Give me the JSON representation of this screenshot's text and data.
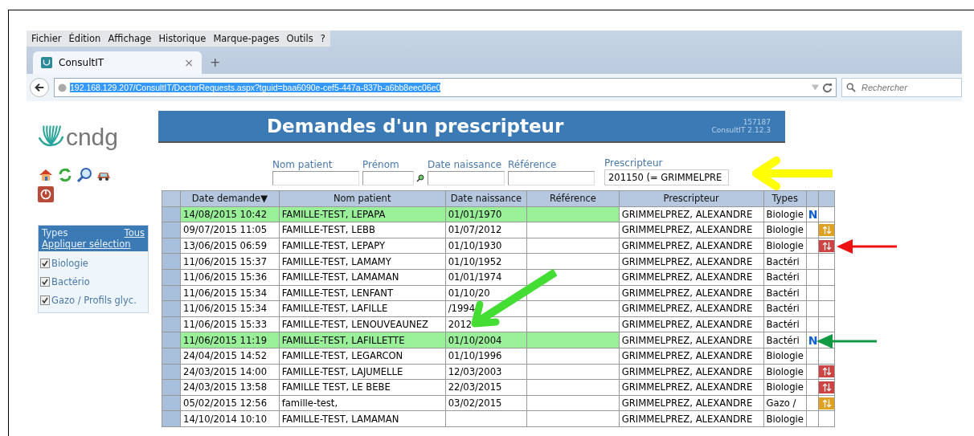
{
  "browser": {
    "menu": [
      "Fichier",
      "Édition",
      "Affichage",
      "Historique",
      "Marque-pages",
      "Outils",
      "?"
    ],
    "tab": {
      "title": "ConsultIT",
      "close": "×",
      "new": "+"
    },
    "url": "192.168.129.207/ConsultIT/DoctorRequests.aspx?tguid=baa6090e-cef5-447a-837b-a6bb8eec06e0",
    "search": {
      "placeholder": "Rechercher"
    }
  },
  "logo": {
    "text": "cndg"
  },
  "banner": {
    "title": "Demandes d'un prescripteur",
    "code": "157187",
    "version": "ConsultIT 2.12.3"
  },
  "types_panel": {
    "title": "Types",
    "all_link": "Tous",
    "apply_link": "Appliquer sélection",
    "items": [
      {
        "label": "Biologie",
        "checked": true
      },
      {
        "label": "Bactério",
        "checked": true
      },
      {
        "label": "Gazo / Profils glyc.",
        "checked": true
      }
    ]
  },
  "filters": [
    {
      "label": "Nom patient",
      "kind": "text"
    },
    {
      "label": "Prénom",
      "kind": "text"
    },
    {
      "label": "Date naissance",
      "kind": "text"
    },
    {
      "label": "Référence",
      "kind": "text"
    },
    {
      "label": "Prescripteur",
      "kind": "select",
      "value": "201150 (= GRIMMELPRE"
    }
  ],
  "table": {
    "columns": [
      "Date demande",
      "Nom patient",
      "Date naissance",
      "Référence",
      "Prescripteur",
      "Types"
    ],
    "sort_marker": "▼",
    "rows": [
      {
        "date": "14/08/2015 10:42",
        "name": "FAMILLE-TEST, LEPAPA",
        "birth": "01/01/1970",
        "prescriber": "GRIMMELPREZ, ALEXANDRE",
        "type": "Biologie",
        "new": "N",
        "highlighted": true
      },
      {
        "date": "09/07/2015 11:05",
        "name": "FAMILLE-TEST, LEBB",
        "birth": "01/07/2012",
        "prescriber": "GRIMMELPREZ, ALEXANDRE",
        "type": "Biologie",
        "color": "#e0a020",
        "highlighted": false
      },
      {
        "date": "13/06/2015 06:59",
        "name": "FAMILLE-TEST, LEPAPY",
        "birth": "01/10/1930",
        "prescriber": "GRIMMELPREZ, ALEXANDRE",
        "type": "Biologie",
        "color": "#cc4444",
        "highlighted": false
      },
      {
        "date": "11/06/2015 15:37",
        "name": "FAMILLE-TEST, LAMAMY",
        "birth": "01/10/1952",
        "prescriber": "GRIMMELPREZ, ALEXANDRE",
        "type": "Bactéri",
        "highlighted": false
      },
      {
        "date": "11/06/2015 15:36",
        "name": "FAMILLE-TEST, LAMAMAN",
        "birth": "01/01/1974",
        "prescriber": "GRIMMELPREZ, ALEXANDRE",
        "type": "Bactéri",
        "highlighted": false
      },
      {
        "date": "11/06/2015 15:34",
        "name": "FAMILLE-TEST, LENFANT",
        "birth": "01/10/20",
        "prescriber": "GRIMMELPREZ, ALEXANDRE",
        "type": "Bactéri",
        "highlighted": false
      },
      {
        "date": "11/06/2015 15:34",
        "name": "FAMILLE-TEST, LAFILLE",
        "birth": "/1994",
        "prescriber": "GRIMMELPREZ, ALEXANDRE",
        "type": "Bactéri",
        "highlighted": false
      },
      {
        "date": "11/06/2015 15:33",
        "name": "FAMILLE-TEST, LENOUVEAUNEZ",
        "birth": "2012",
        "prescriber": "GRIMMELPREZ, ALEXANDRE",
        "type": "Bactéri",
        "highlighted": false
      },
      {
        "date": "11/06/2015 11:19",
        "name": "FAMILLE-TEST, LAFILLETTE",
        "birth": "01/10/2004",
        "prescriber": "GRIMMELPREZ, ALEXANDRE",
        "type": "Bactéri",
        "new": "N",
        "highlighted": true
      },
      {
        "date": "24/04/2015 14:52",
        "name": "FAMILLE-TEST, LEGARCON",
        "birth": "01/10/1996",
        "prescriber": "GRIMMELPREZ, ALEXANDRE",
        "type": "Biologie",
        "highlighted": false
      },
      {
        "date": "24/03/2015 14:00",
        "name": "FAMILLE-TEST, LAJUMELLE",
        "birth": "12/03/2003",
        "prescriber": "GRIMMELPREZ, ALEXANDRE",
        "type": "Biologie",
        "color": "#cc4444",
        "highlighted": false
      },
      {
        "date": "24/03/2015 13:58",
        "name": "FAMILLE TEST, LE BEBE",
        "birth": "22/03/2015",
        "prescriber": "GRIMMELPREZ, ALEXANDRE",
        "type": "Biologie",
        "color": "#cc4444",
        "highlighted": false
      },
      {
        "date": "05/02/2015 12:56",
        "name": "famille-test,",
        "birth": "03/02/2015",
        "prescriber": "GRIMMELPREZ, ALEXANDRE",
        "type": "Gazo /",
        "color": "#e0a020",
        "highlighted": false
      },
      {
        "date": "14/10/2014 10:10",
        "name": "FAMILLE-TEST, LAMAMAN",
        "birth": "",
        "prescriber": "GRIMMELPREZ, ALEXANDRE",
        "type": "Biologie",
        "highlighted": false
      }
    ]
  },
  "annotations": [
    {
      "kind": "big-arrow",
      "color": "#ffff00"
    },
    {
      "kind": "big-arrow",
      "color": "#44dd33"
    },
    {
      "kind": "small-arrow",
      "color": "#ee1111"
    },
    {
      "kind": "small-arrow",
      "color": "#119944"
    }
  ]
}
